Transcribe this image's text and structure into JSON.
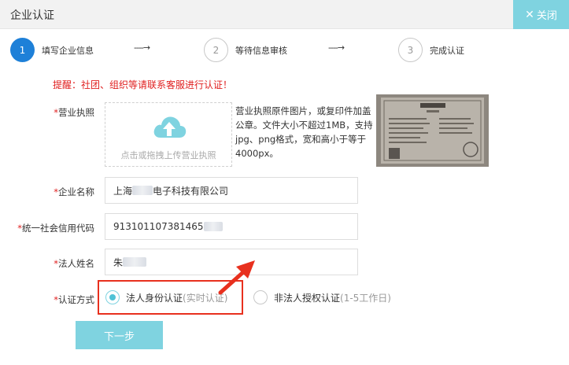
{
  "window": {
    "title": "企业认证",
    "close_label": "关闭"
  },
  "steps": [
    {
      "number": "1",
      "label": "填写企业信息",
      "state": "active"
    },
    {
      "number": "2",
      "label": "等待信息审核",
      "state": "inactive"
    },
    {
      "number": "3",
      "label": "完成认证",
      "state": "inactive"
    }
  ],
  "step_arrow": "----→",
  "reminder": "提醒：社团、组织等请联系客服进行认证！",
  "form": {
    "required_mark": "*",
    "license_label": "营业执照",
    "upload_placeholder": "点击或拖拽上传营业执照",
    "upload_desc": "营业执照原件图片，或复印件加盖公章。文件大小不超过1MB，支持jpg、png格式，宽和高小于等于4000px。",
    "company_name_label": "企业名称",
    "company_name_prefix": "上海",
    "company_name_suffix": "电子科技有限公司",
    "credit_code_label": "统一社会信用代码",
    "credit_code_value": "913101107381465",
    "legal_person_label": "法人姓名",
    "legal_person_value": "朱",
    "auth_method_label": "认证方式",
    "auth_options": [
      {
        "label": "法人身份认证",
        "hint": "(实时认证)",
        "checked": true
      },
      {
        "label": "非法人授权认证",
        "hint": "(1-5工作日)",
        "checked": false
      }
    ]
  },
  "next_button": "下一步",
  "colors": {
    "accent": "#7fd3e0",
    "step_active": "#1e80d8",
    "alert": "#e02020",
    "highlight": "#e8301e"
  },
  "icons": [
    "close-icon",
    "cloud-upload-icon",
    "arrow-pointer-icon"
  ]
}
